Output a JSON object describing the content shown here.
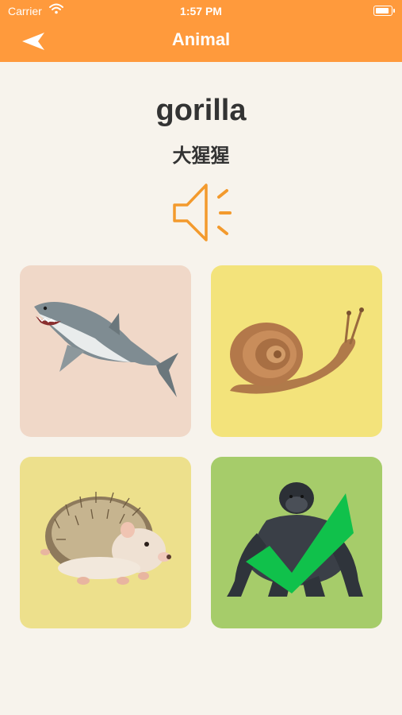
{
  "status_bar": {
    "carrier": "Carrier",
    "time": "1:57 PM"
  },
  "nav": {
    "title": "Animal",
    "back_icon": "back-arrow-icon"
  },
  "word": {
    "english": "gorilla",
    "chinese": "大猩猩"
  },
  "speaker_icon": "speaker-icon",
  "options": [
    {
      "animal": "shark",
      "background": "#f0d8c8",
      "correct": false
    },
    {
      "animal": "snail",
      "background": "#f3e37b",
      "correct": false
    },
    {
      "animal": "hedgehog",
      "background": "#ede08c",
      "correct": false
    },
    {
      "animal": "gorilla",
      "background": "#a6cc6a",
      "correct": true,
      "check_color": "#10c14b"
    }
  ],
  "colors": {
    "nav_bar": "#ff9a3c",
    "background": "#f7f3ec",
    "speaker": "#f39a2d"
  }
}
